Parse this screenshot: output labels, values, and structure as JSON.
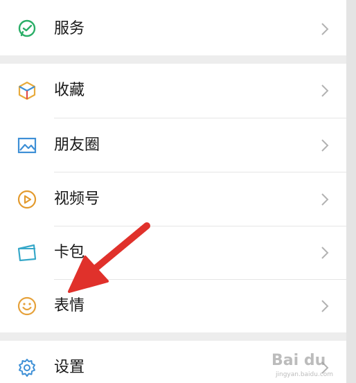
{
  "menu": {
    "service": {
      "label": "服务",
      "icon": "service-icon",
      "color": "#2aae67"
    },
    "favorites": {
      "label": "收藏",
      "icon": "favorites-cube-icon",
      "color": "#e8ab3c"
    },
    "moments": {
      "label": "朋友圈",
      "icon": "moments-image-icon",
      "color": "#3d8fd6"
    },
    "channels": {
      "label": "视频号",
      "icon": "channels-play-icon",
      "color": "#e39a2d"
    },
    "cards": {
      "label": "卡包",
      "icon": "card-wallet-icon",
      "color": "#37a8c9"
    },
    "stickers": {
      "label": "表情",
      "icon": "sticker-smile-icon",
      "color": "#e6a13a"
    },
    "settings": {
      "label": "设置",
      "icon": "settings-gear-icon",
      "color": "#3d8fd6"
    }
  },
  "chevron_icon": "chevron-right-icon",
  "annotation": {
    "type": "red-arrow",
    "color": "#e0312b",
    "target": "表情"
  },
  "watermark": {
    "brand": "Bai du",
    "sub": "jingyan.baidu.com"
  }
}
